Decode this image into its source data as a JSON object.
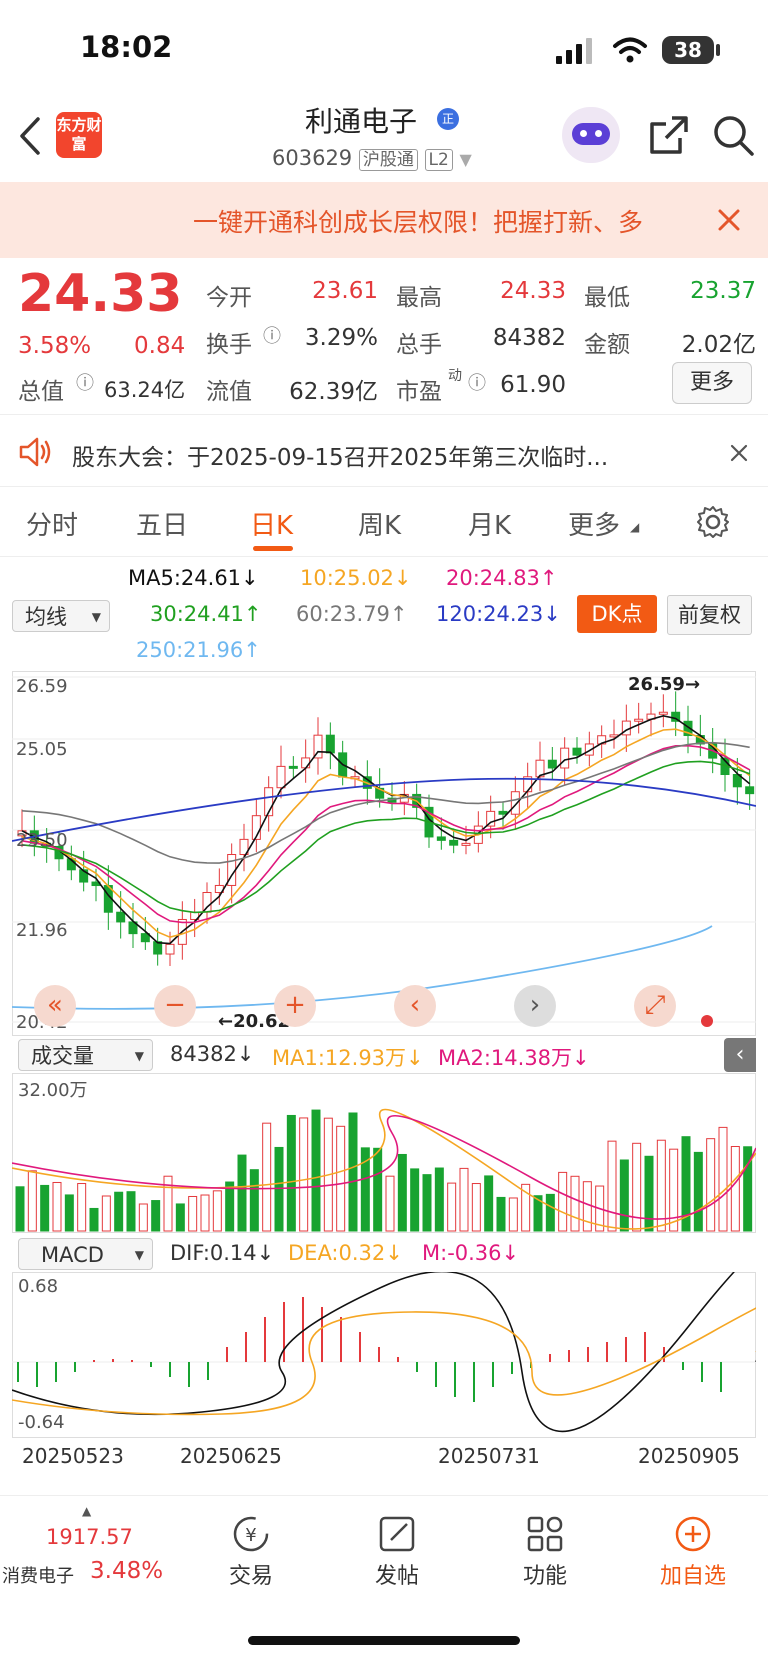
{
  "status": {
    "time": "18:02",
    "battery": "38"
  },
  "header": {
    "logo_text": "东方财富",
    "name": "利通电子",
    "code": "603629",
    "tag1": "沪股通",
    "tag2": "L2"
  },
  "banner": {
    "text": "一键开通科创成长层权限！把握打新、多"
  },
  "quote": {
    "price": "24.33",
    "change_pct": "3.58%",
    "change": "0.84",
    "open_label": "今开",
    "open": "23.61",
    "high_label": "最高",
    "high": "24.33",
    "low_label": "最低",
    "low": "23.37",
    "turnover_label": "换手",
    "turnover": "3.29%",
    "volume_label": "总手",
    "volume": "84382",
    "amount_label": "金额",
    "amount": "2.02亿",
    "mktcap_label": "总值",
    "mktcap": "63.24亿",
    "float_label": "流值",
    "float": "62.39亿",
    "pe_label": "市盈",
    "pe_sup": "动",
    "pe": "61.90",
    "more": "更多"
  },
  "notice": {
    "text": "股东大会：于2025-09-15召开2025年第三次临时..."
  },
  "tabs": [
    "分时",
    "五日",
    "日K",
    "周K",
    "月K",
    "更多"
  ],
  "ma_legend": {
    "ma5": "MA5:24.61↓",
    "ma10": "10:25.02↓",
    "ma20": "20:24.83↑",
    "ma30": "30:24.41↑",
    "ma60": "60:23.79↑",
    "ma120": "120:24.23↓",
    "ma250": "250:21.96↑",
    "select": "均线",
    "dk": "DK点",
    "fq": "前复权"
  },
  "colors": {
    "up": "#e4393c",
    "down": "#18a330",
    "ma5": "#111111",
    "ma10": "#f5a623",
    "ma20": "#e0197d",
    "ma30": "#20a020",
    "ma60": "#777777",
    "ma120": "#2a3bc4",
    "ma250": "#6fb8f0",
    "accent": "#f25a14"
  },
  "kline_axis": {
    "top": "26.59",
    "l2": "25.05",
    "l3": "23.50",
    "l4": "21.96",
    "bottom": "20.42",
    "max_mark": "26.59",
    "min_mark": "20.62"
  },
  "volume": {
    "select": "成交量",
    "vol": "84382↓",
    "ma1": "MA1:12.93万↓",
    "ma2": "MA2:14.38万↓",
    "top": "32.00万"
  },
  "macd": {
    "select": "MACD",
    "dif": "DIF:0.14↓",
    "dea": "DEA:0.32↓",
    "m": "M:-0.36↓",
    "top": "0.68",
    "bottom": "-0.64"
  },
  "dates": [
    "20250523",
    "20250625",
    "20250731",
    "20250905"
  ],
  "bottom_bar": {
    "index_value": "1917.57",
    "index_name": "消费电子",
    "index_change": "3.48%",
    "items": [
      "交易",
      "发帖",
      "功能",
      "加自选"
    ]
  }
}
